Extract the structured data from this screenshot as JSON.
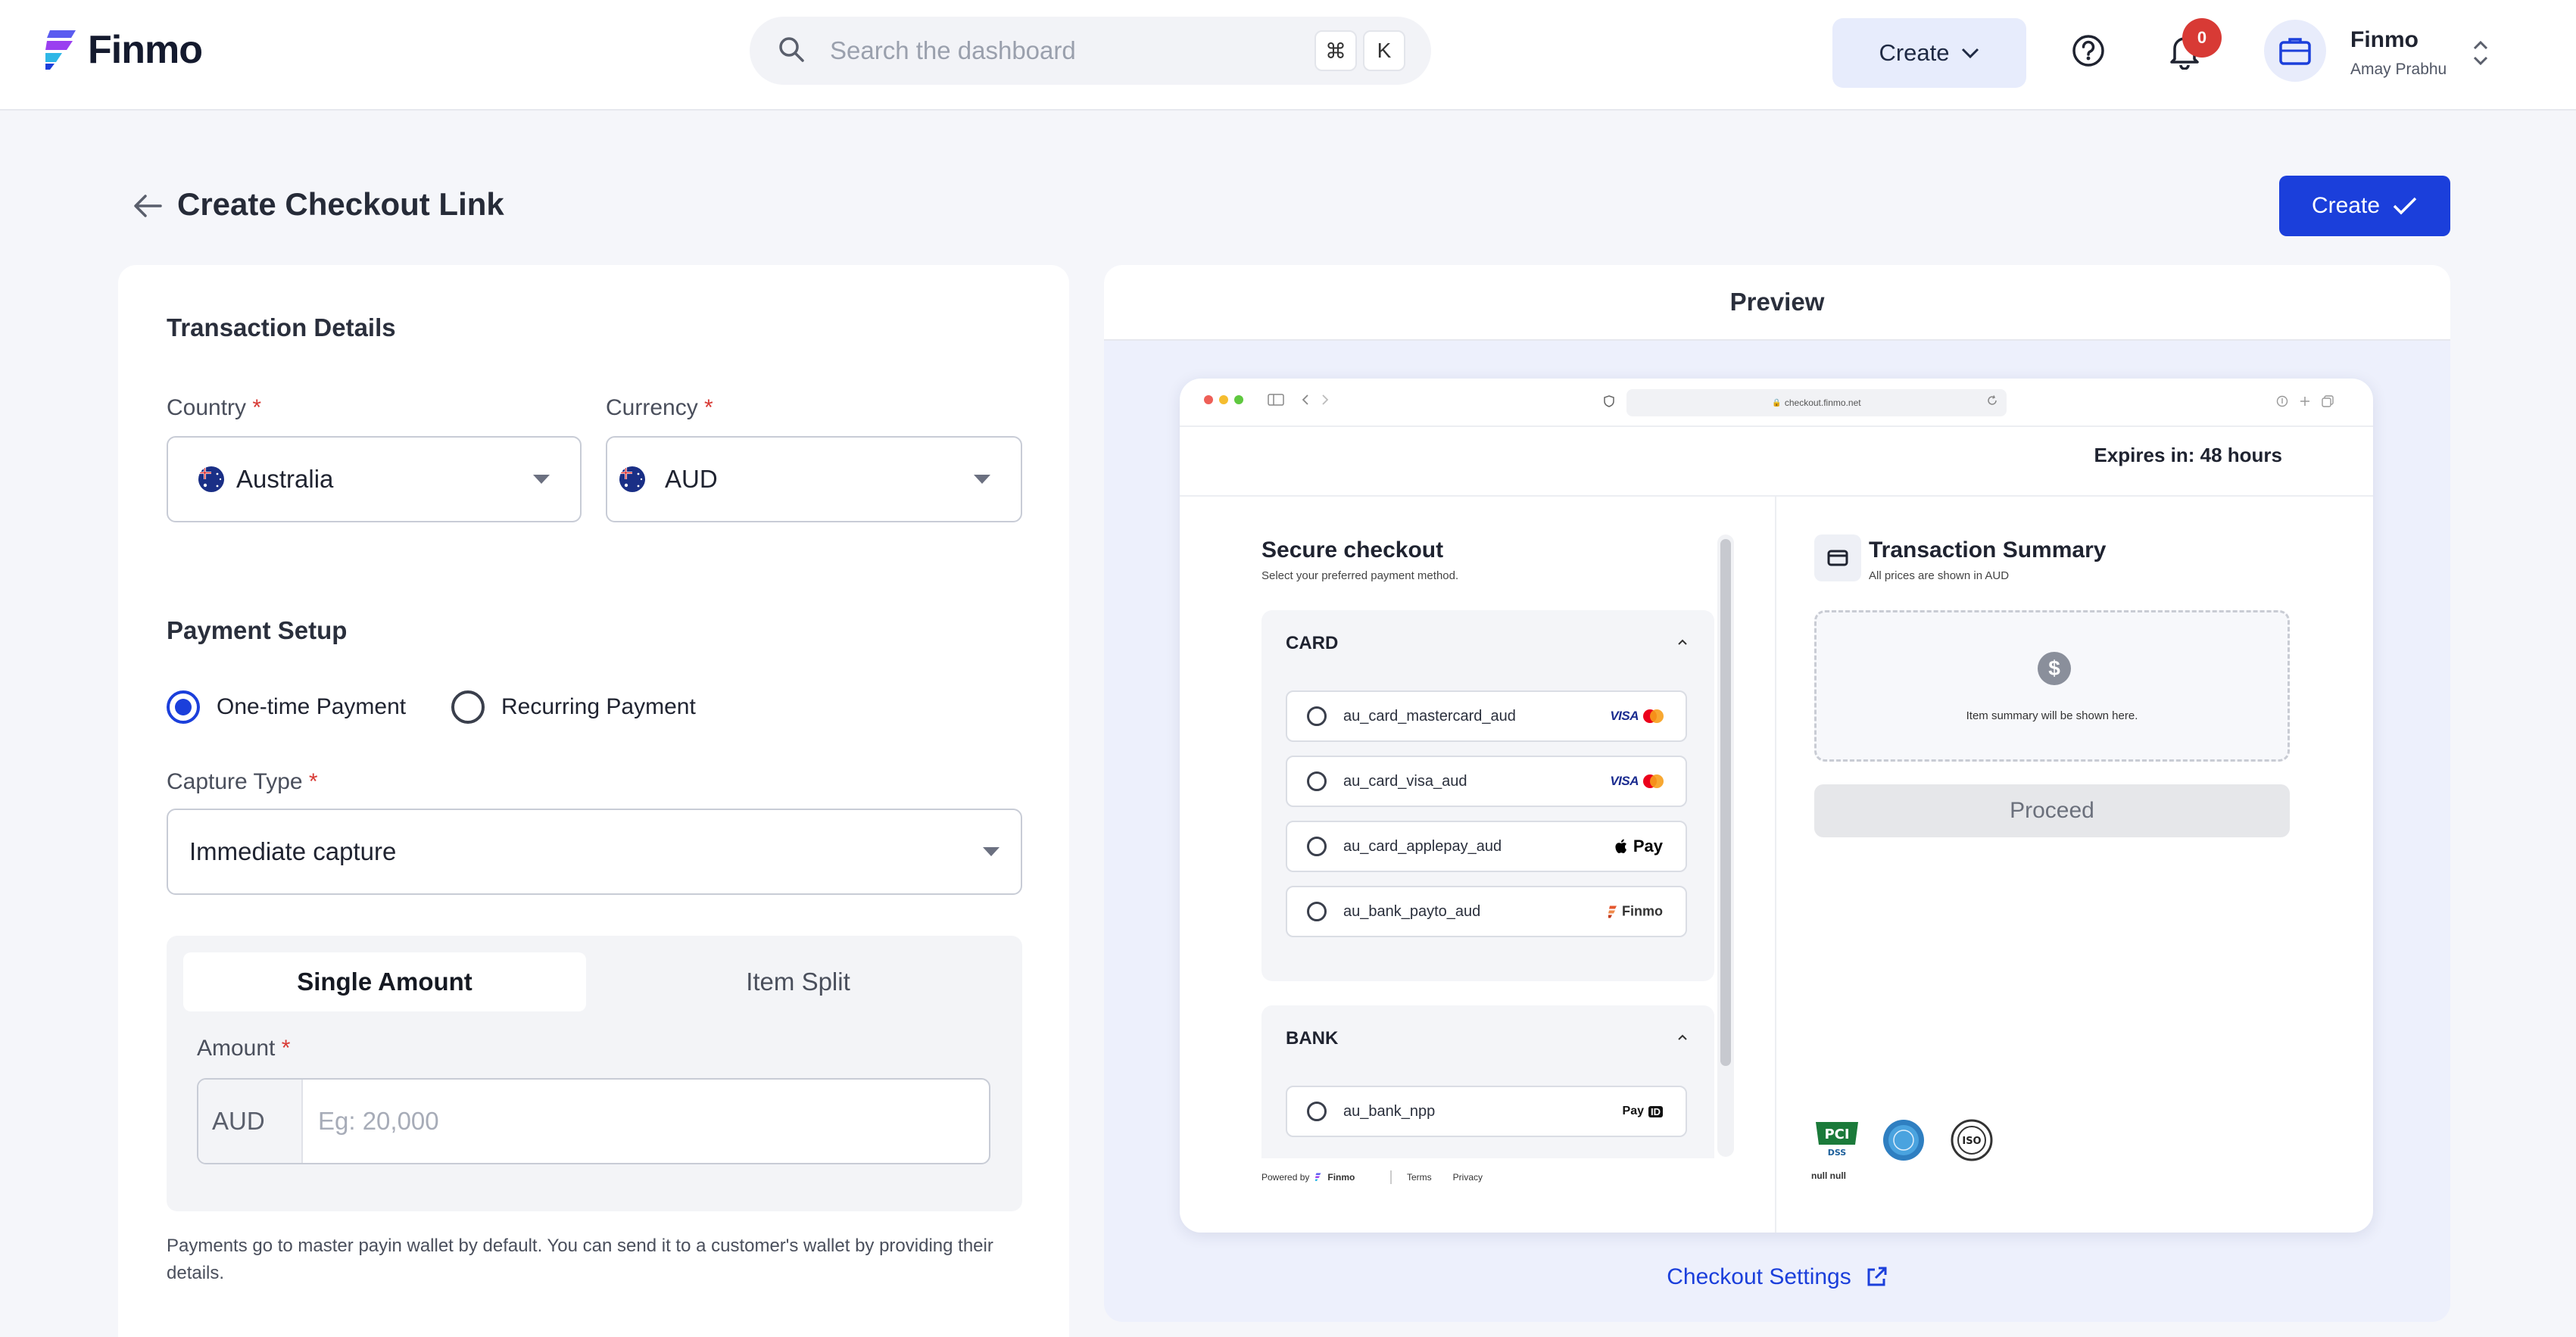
{
  "topbar": {
    "brand": "Finmo",
    "search_placeholder": "Search the dashboard",
    "kbd_cmd": "⌘",
    "kbd_key": "K",
    "create_label": "Create",
    "notification_count": "0",
    "user_name": "Finmo",
    "user_sub": "Amay Prabhu"
  },
  "header": {
    "title": "Create Checkout Link",
    "create_button": "Create"
  },
  "form": {
    "section_transaction": "Transaction Details",
    "country_label": "Country",
    "country_value": "Australia",
    "currency_label": "Currency",
    "currency_value": "AUD",
    "section_payment": "Payment Setup",
    "payment_options": [
      "One-time Payment",
      "Recurring Payment"
    ],
    "selected_payment": "One-time Payment",
    "capture_label": "Capture Type",
    "capture_value": "Immediate capture",
    "tabs": [
      "Single Amount",
      "Item Split"
    ],
    "active_tab": "Single Amount",
    "amount_label": "Amount",
    "amount_prefix": "AUD",
    "amount_placeholder": "Eg: 20,000",
    "note": "Payments go to master payin wallet by default. You can send it to a customer's wallet by providing their details.",
    "required_marker": "*"
  },
  "preview": {
    "title": "Preview",
    "url": "checkout.finmo.net",
    "expires": "Expires in: 48 hours",
    "secure_title": "Secure checkout",
    "secure_sub": "Select your preferred payment method.",
    "groups": [
      {
        "title": "CARD",
        "methods": [
          "au_card_mastercard_aud",
          "au_card_visa_aud",
          "au_card_applepay_aud",
          "au_bank_payto_aud"
        ]
      },
      {
        "title": "BANK",
        "methods": [
          "au_bank_npp"
        ]
      }
    ],
    "logo_visa": "VISA",
    "logo_pay": "Pay",
    "logo_finmo": "Finmo",
    "logo_payid_pay": "Pay",
    "logo_payid_id": "ID",
    "powered_by": "Powered by",
    "powered_brand": "Finmo",
    "footer_links": [
      "Terms",
      "Privacy"
    ],
    "summary_title": "Transaction Summary",
    "summary_sub": "All prices are shown in AUD",
    "summary_icon": "$",
    "summary_empty": "Item summary will be shown here.",
    "proceed_label": "Proceed",
    "cert_label": "null null",
    "settings_link": "Checkout Settings"
  },
  "colors": {
    "primary": "#1b3fdb",
    "badge": "#d83a35",
    "preview_bg": "#edf0fc"
  }
}
